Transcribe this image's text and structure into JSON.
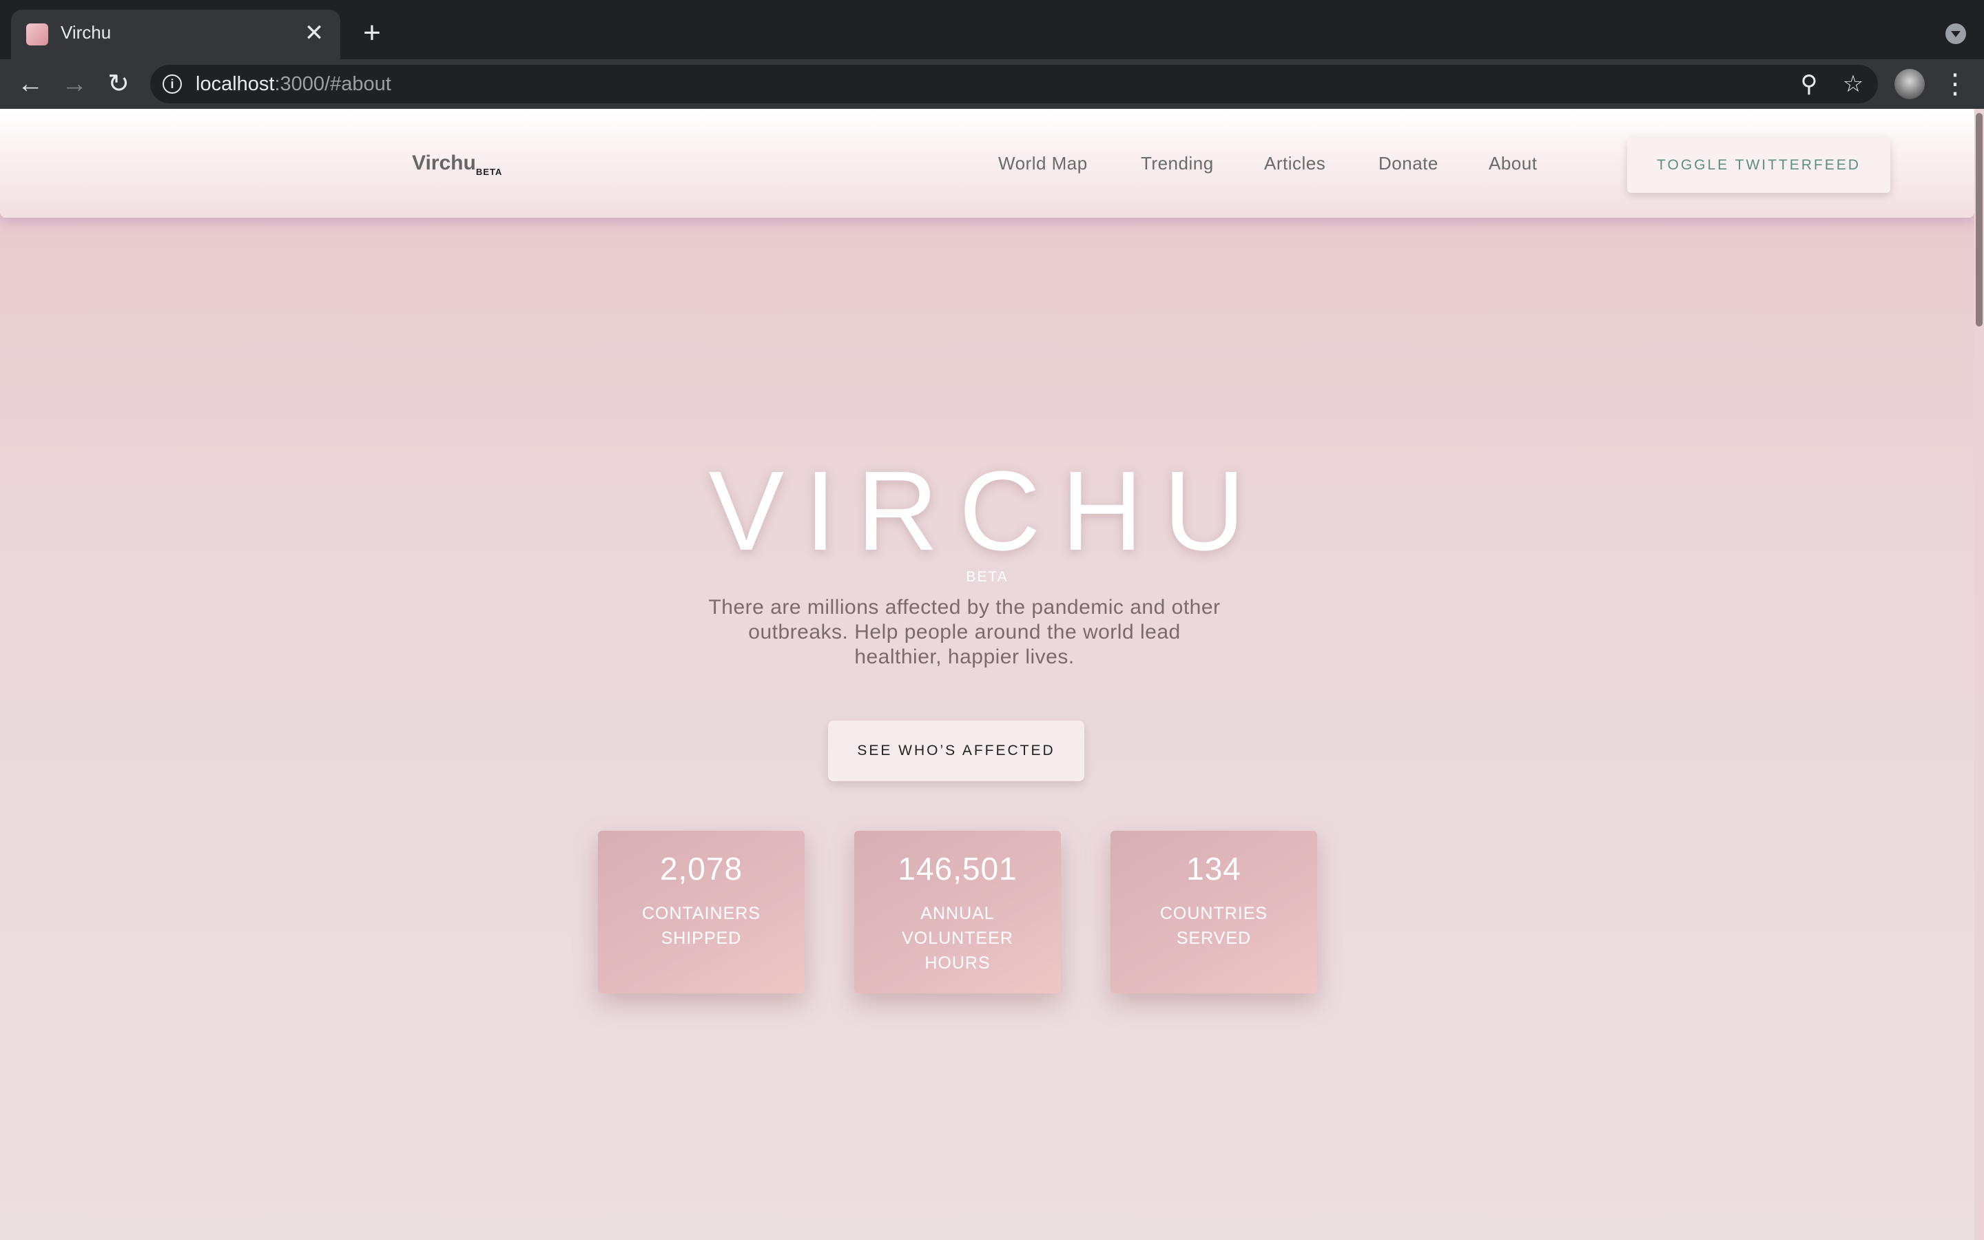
{
  "browser": {
    "tab_title": "Virchu",
    "close_glyph": "✕",
    "new_tab_glyph": "+",
    "url_host": "localhost",
    "url_rest": ":3000/#about",
    "back_glyph": "←",
    "forward_glyph": "→",
    "reload_glyph": "↻",
    "info_glyph": "i",
    "zoom_glyph": "⚲",
    "star_glyph": "☆",
    "more_glyph": "⋮"
  },
  "navbar": {
    "brand": "Virchu",
    "brand_badge": "BETA",
    "links": [
      "World Map",
      "Trending",
      "Articles",
      "Donate",
      "About"
    ],
    "toggle_label": "TOGGLE TWITTERFEED"
  },
  "hero": {
    "title": "VIRCHU",
    "badge": "BETA",
    "description": "There are millions affected by the pandemic and other outbreaks. Help people around the world lead healthier, happier lives.",
    "cta_label": "SEE WHO’S AFFECTED"
  },
  "stats": [
    {
      "value": "2,078",
      "label": "CONTAINERS SHIPPED"
    },
    {
      "value": "146,501",
      "label": "ANNUAL VOLUNTEER HOURS"
    },
    {
      "value": "134",
      "label": "COUNTRIES SERVED"
    }
  ],
  "colors": {
    "chrome_dark": "#202124",
    "chrome_mid": "#35363a",
    "page_pink": "#ecdfe1",
    "card_pink": "#e4bcbf",
    "toggle_text": "#5b8f7f"
  },
  "icons": [
    "favicon-icon",
    "close-icon",
    "plus-icon",
    "back-arrow-icon",
    "forward-arrow-icon",
    "reload-icon",
    "info-icon",
    "zoom-icon",
    "star-icon",
    "more-vert-icon",
    "chevron-down-icon"
  ]
}
